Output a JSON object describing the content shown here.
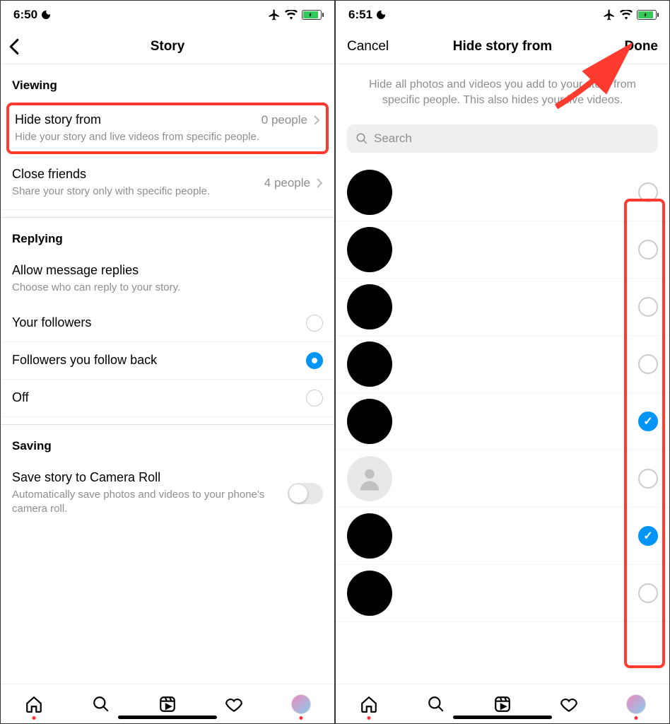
{
  "left": {
    "status": {
      "time": "6:50"
    },
    "nav": {
      "title": "Story"
    },
    "sections": {
      "viewing": {
        "header": "Viewing",
        "hide_story": {
          "title": "Hide story from",
          "value": "0 people",
          "sub": "Hide your story and live videos from specific people."
        },
        "close_friends": {
          "title": "Close friends",
          "value": "4 people",
          "sub": "Share your story only with specific people."
        }
      },
      "replying": {
        "header": "Replying",
        "allow": {
          "title": "Allow message replies",
          "sub": "Choose who can reply to your story."
        },
        "opt1": "Your followers",
        "opt2": "Followers you follow back",
        "opt3": "Off"
      },
      "saving": {
        "header": "Saving",
        "camera_roll": {
          "title": "Save story to Camera Roll",
          "sub": "Automatically save photos and videos to your phone's camera roll."
        }
      }
    }
  },
  "right": {
    "status": {
      "time": "6:51"
    },
    "nav": {
      "cancel": "Cancel",
      "title": "Hide story from",
      "done": "Done"
    },
    "description": "Hide all photos and videos you add to your story from specific people. This also hides your live videos.",
    "search_placeholder": "Search",
    "users": [
      {
        "checked": false,
        "placeholder": false
      },
      {
        "checked": false,
        "placeholder": false
      },
      {
        "checked": false,
        "placeholder": false
      },
      {
        "checked": false,
        "placeholder": false
      },
      {
        "checked": true,
        "placeholder": false
      },
      {
        "checked": false,
        "placeholder": true
      },
      {
        "checked": true,
        "placeholder": false
      },
      {
        "checked": false,
        "placeholder": false
      }
    ]
  }
}
